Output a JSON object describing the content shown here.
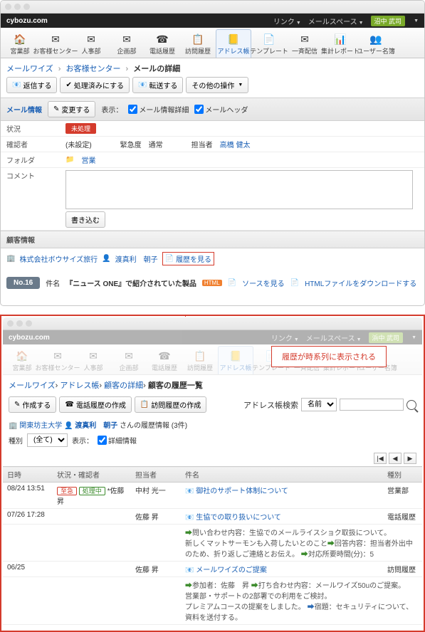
{
  "top": {
    "brand": "cybozu.com",
    "link_menu": "リンク",
    "mailspace": "メールスペース",
    "user": "沼中 武司"
  },
  "iconbar": {
    "items": [
      {
        "name": "home",
        "label": "宮業部",
        "glyph": "🏠"
      },
      {
        "name": "customer-center",
        "label": "お客様センター",
        "glyph": "✉"
      },
      {
        "name": "hr",
        "label": "人事部",
        "glyph": "✉"
      },
      {
        "name": "planning",
        "label": "企画部",
        "glyph": "✉"
      },
      {
        "name": "phone-history",
        "label": "電話履歴",
        "glyph": "☎"
      },
      {
        "name": "visit-history",
        "label": "訪問履歴",
        "glyph": "📋"
      },
      {
        "name": "address",
        "label": "アドレス帳",
        "glyph": "📒"
      },
      {
        "name": "template",
        "label": "テンプレート",
        "glyph": "📄"
      },
      {
        "name": "batch-assign",
        "label": "一斉配信",
        "glyph": "✉"
      },
      {
        "name": "report",
        "label": "集計レポート",
        "glyph": "📊"
      },
      {
        "name": "user-list",
        "label": "ユーザー名簿",
        "glyph": "👥"
      }
    ]
  },
  "breadcrumb1": {
    "a": "メールワイズ",
    "b": "お客様センター",
    "c": "メールの詳細"
  },
  "buttons1": {
    "reply": "返信する",
    "done": "処理済みにする",
    "fwd": "転送する",
    "other": "その他の操作"
  },
  "tabrow1": {
    "tab": "メール情報",
    "change": "変更する",
    "show": "表示：",
    "cb1": "メール情報詳細",
    "cb2": "メールヘッダ"
  },
  "form": {
    "status_label": "状況",
    "status_value": "未処理",
    "confirm_label": "確認者",
    "confirm_value": "(未設定)",
    "urgency_label": "緊急度",
    "urgency_value": "通常",
    "assignee_label": "担当者",
    "assignee_value": "高橋 健太",
    "folder_label": "フォルダ",
    "folder_value": "営業",
    "comment_label": "コメント",
    "write": "書き込む"
  },
  "custinfo": {
    "title": "顧客情報",
    "company": "株式会社ボウサイズ旅行",
    "person": "渡真利　朝子",
    "history_link": "履歴を見る"
  },
  "subject": {
    "no": "No.16",
    "label": "件名",
    "title": "『ニュース ONE』で紹介されていた製品",
    "src": "ソースを見る",
    "dl": "HTMLファイルをダウンロードする",
    "html": "HTML"
  },
  "callout": "履歴が時系列に表示される",
  "top2_user": "浜中 武司",
  "breadcrumb2": {
    "a": "メールワイズ",
    "b": "アドレス帳",
    "c": "顧客の詳細",
    "d": "顧客の履歴一覧"
  },
  "buttons2": {
    "create": "作成する",
    "phone": "電話履歴の作成",
    "visit": "訪問履歴の作成"
  },
  "search": {
    "label": "アドレス帳検索",
    "sel": "名前"
  },
  "custtitle": {
    "org": "関東坊主大学",
    "person": "渡真利　朝子",
    "suffix": "さんの履歴情報 (3件)"
  },
  "filter": {
    "label": "種別",
    "sel": "(全て)",
    "show": "表示：",
    "cb": "詳細情報"
  },
  "table": {
    "headers": {
      "date": "日時",
      "status": "状況・確認者",
      "assignee": "担当者",
      "subject": "件名",
      "type": "種別"
    },
    "rows": [
      {
        "date": "08/24 13:51",
        "urgent": "至急",
        "proc": "処理中",
        "person": "*佐藤 昇",
        "assignee": "中村 光一",
        "subj": "御社のサポート体制について",
        "type": "営業部"
      },
      {
        "date": "07/26 17:28",
        "assignee": "佐藤 昇",
        "subj": "生協での取り扱いについて",
        "type": "電話履歴",
        "detail1": "問い合わせ内容：生協でのメールライスショク取扱について。",
        "detail1b": "新しくマットサーモンも入荷したいとのこと",
        "detail2": "回答内容：担当者外出中のため、折り返しご連絡とお伝え。",
        "detail3": "対応所要時間(分)：5"
      },
      {
        "date": "06/25",
        "assignee": "佐藤 昇",
        "subj": "メールワイズのご提案",
        "type": "訪問履歴",
        "detail1": "参加者：佐藤　昇",
        "detail1b": "打ち合わせ内容：メールワイズ50uのご提案。",
        "detail2": "営業部・サポートの2部署での利用をご検討。",
        "detail3": "プレミアムコースの提案をしました。",
        "detail4": "宿題：セキュリティについて、資料を送付する。"
      }
    ]
  }
}
